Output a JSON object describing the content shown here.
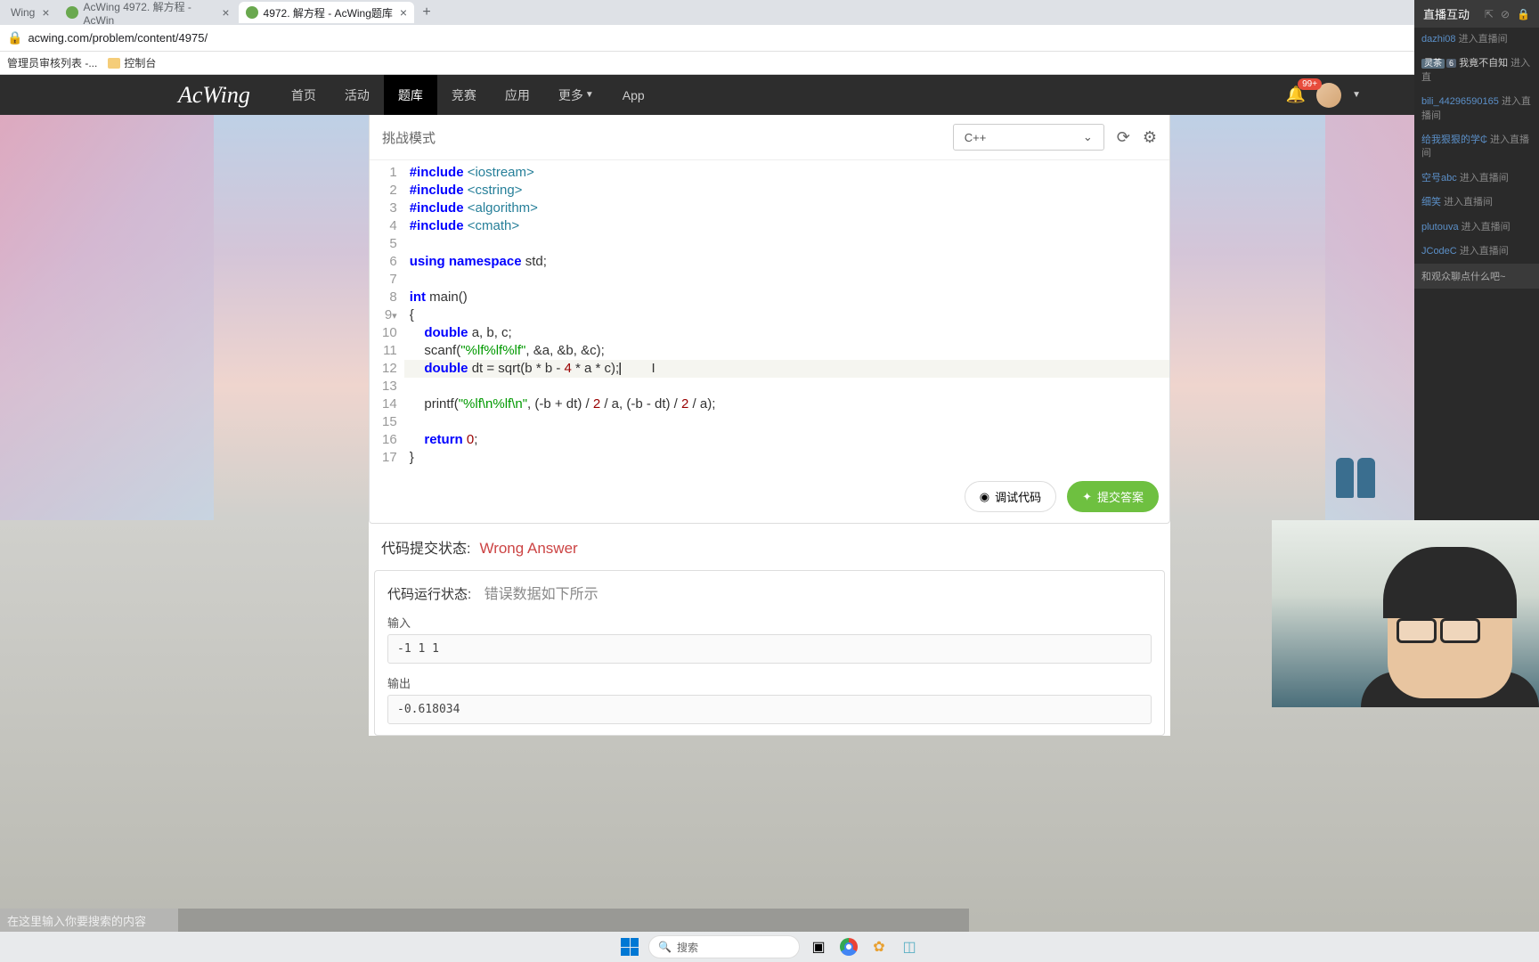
{
  "browser": {
    "tabs": [
      {
        "title": "Wing",
        "active": false
      },
      {
        "title": "AcWing 4972. 解方程 - AcWin",
        "active": false
      },
      {
        "title": "4972. 解方程 - AcWing题库",
        "active": true
      }
    ],
    "url": "acwing.com/problem/content/4975/",
    "bookmarks": [
      {
        "label": "管理员审核列表 -..."
      },
      {
        "label": "控制台"
      }
    ]
  },
  "nav": {
    "logo": "AcWing",
    "items": [
      "首页",
      "活动",
      "题库",
      "竞赛",
      "应用",
      "更多 ",
      "App"
    ],
    "active_index": 2,
    "badge": "99+"
  },
  "editor": {
    "challenge_label": "挑战模式",
    "language": "C++",
    "highlighted_line": 12,
    "code_tokens": [
      [
        [
          "kw",
          "#include"
        ],
        [
          "",
          " "
        ],
        [
          "type",
          "<iostream>"
        ]
      ],
      [
        [
          "kw",
          "#include"
        ],
        [
          "",
          " "
        ],
        [
          "type",
          "<cstring>"
        ]
      ],
      [
        [
          "kw",
          "#include"
        ],
        [
          "",
          " "
        ],
        [
          "type",
          "<algorithm>"
        ]
      ],
      [
        [
          "kw",
          "#include"
        ],
        [
          "",
          " "
        ],
        [
          "type",
          "<cmath>"
        ]
      ],
      [],
      [
        [
          "kw",
          "using"
        ],
        [
          "",
          " "
        ],
        [
          "kw",
          "namespace"
        ],
        [
          "",
          " std;"
        ]
      ],
      [],
      [
        [
          "kw",
          "int"
        ],
        [
          "",
          " main()"
        ]
      ],
      [
        [
          "",
          "{"
        ]
      ],
      [
        [
          "",
          "    "
        ],
        [
          "kw",
          "double"
        ],
        [
          "",
          " a, b, c;"
        ]
      ],
      [
        [
          "",
          "    scanf("
        ],
        [
          "str",
          "\"%lf%lf%lf\""
        ],
        [
          "",
          ", &a, &b, &c);"
        ]
      ],
      [
        [
          "",
          "    "
        ],
        [
          "kw",
          "double"
        ],
        [
          "",
          " dt = sqrt(b * b - "
        ],
        [
          "num",
          "4"
        ],
        [
          "",
          " * a * c);"
        ]
      ],
      [],
      [
        [
          "",
          "    printf("
        ],
        [
          "str",
          "\"%lf\\n%lf\\n\""
        ],
        [
          "",
          ", (-b + dt) / "
        ],
        [
          "num",
          "2"
        ],
        [
          "",
          " / a, (-b - dt) / "
        ],
        [
          "num",
          "2"
        ],
        [
          "",
          " / a);"
        ]
      ],
      [],
      [
        [
          "",
          "    "
        ],
        [
          "kw",
          "return"
        ],
        [
          "",
          " "
        ],
        [
          "num",
          "0"
        ],
        [
          "",
          ";"
        ]
      ],
      [
        [
          "",
          "}"
        ]
      ]
    ],
    "debug_label": "调试代码",
    "submit_label": "提交答案"
  },
  "status": {
    "submit_label": "代码提交状态:",
    "submit_value": "Wrong Answer",
    "run_label": "代码运行状态:",
    "run_sub": "错误数据如下所示",
    "input_label": "输入",
    "input_value": "-1 1 1",
    "output_label": "输出",
    "output_value": "-0.618034"
  },
  "live": {
    "title": "直播互动",
    "messages": [
      {
        "user": "dazhi08",
        "action": "进入直播间"
      },
      {
        "user": "灵茶",
        "badge": "6",
        "text": "我竟不自知",
        "action": "进入直"
      },
      {
        "user": "bili_44296590165",
        "action": "进入直播间"
      },
      {
        "user": "给我狠狠的学₵",
        "action": "进入直播间"
      },
      {
        "user": "空号abc",
        "action": "进入直播间"
      },
      {
        "user": "细笑",
        "action": "进入直播间"
      },
      {
        "user": "plutouva",
        "action": "进入直播间"
      },
      {
        "user": "JCodeC",
        "action": "进入直播间"
      }
    ],
    "hint": "和观众聊点什么吧~"
  },
  "bottom_search": {
    "placeholder": "在这里输入你要搜索的内容"
  },
  "taskbar": {
    "search_placeholder": "搜索"
  }
}
